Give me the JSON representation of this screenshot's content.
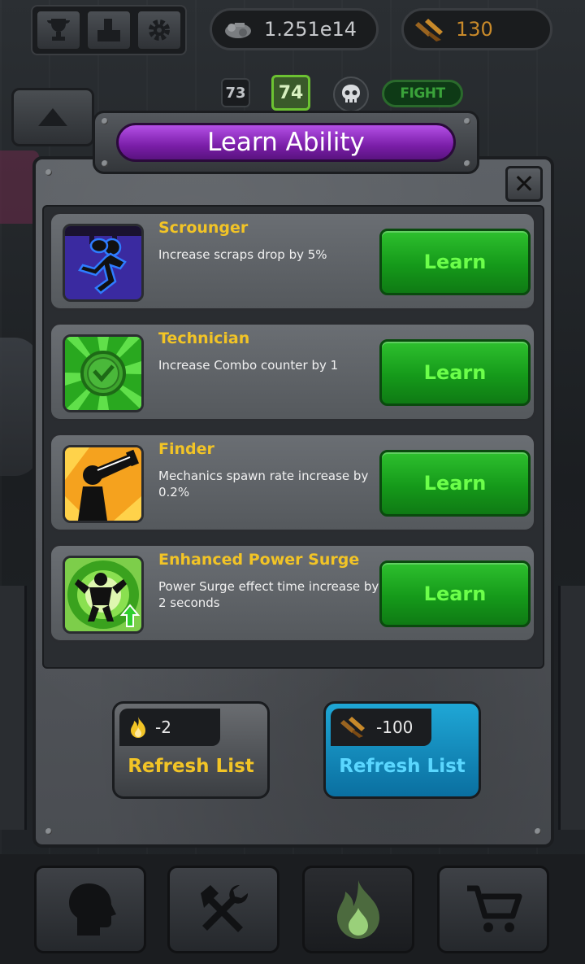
{
  "topbar": {
    "scraps_value": "1.251e14",
    "bolts_value": "130"
  },
  "levels": {
    "previous": "73",
    "current": "74",
    "fight_label": "FIGHT"
  },
  "dialog": {
    "title": "Learn Ability",
    "close_glyph": "✕"
  },
  "abilities": [
    {
      "name": "Scrounger",
      "description": "Increase scraps drop by 5%",
      "icon": "running-thief-icon",
      "button_label": "Learn"
    },
    {
      "name": "Technician",
      "description": "Increase Combo counter by 1",
      "icon": "checkmark-burst-icon",
      "button_label": "Learn"
    },
    {
      "name": "Finder",
      "description": "Mechanics spawn rate increase by 0.2%",
      "icon": "telescope-man-icon",
      "button_label": "Learn"
    },
    {
      "name": "Enhanced Power Surge",
      "description": "Power Surge effect time increase by 2 seconds",
      "icon": "power-surge-man-icon",
      "button_label": "Learn"
    }
  ],
  "refresh_buttons": [
    {
      "cost": "-2",
      "label": "Refresh List",
      "currency_icon": "flame-icon"
    },
    {
      "cost": "-100",
      "label": "Refresh List",
      "currency_icon": "bolts-icon"
    }
  ],
  "bottom_nav": [
    {
      "icon": "head-profile-icon"
    },
    {
      "icon": "tools-icon"
    },
    {
      "icon": "flame-icon",
      "active": true
    },
    {
      "icon": "cart-icon"
    }
  ],
  "colors": {
    "title_purple": "#8a2bc2",
    "learn_green": "#1aa61e",
    "ability_name_gold": "#f2c426",
    "refresh_blue": "#1393c6"
  }
}
